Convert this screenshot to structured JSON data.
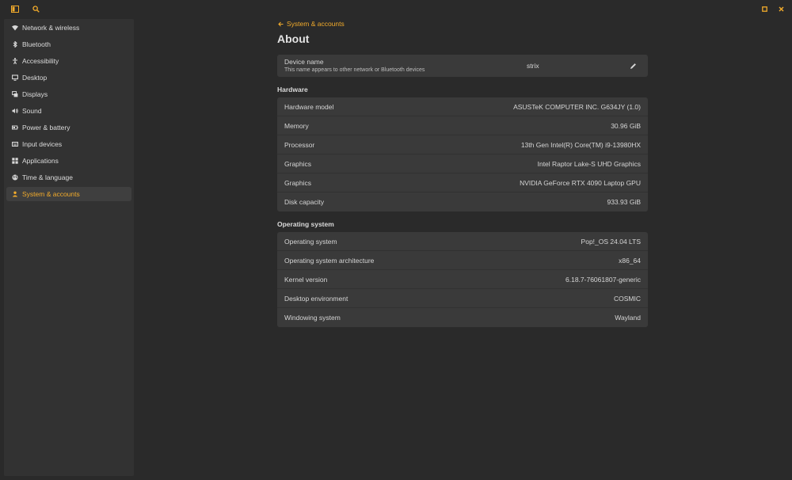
{
  "header": {
    "sidebar_toggle_icon": "sidebar-toggle-icon",
    "search_icon": "search-icon",
    "maximize_icon": "maximize-icon",
    "close_icon": "close-icon"
  },
  "colors": {
    "accent": "#f2ab2b",
    "background": "#2a2a2a",
    "panel": "#323232",
    "card": "#3a3a3a"
  },
  "sidebar": {
    "items": [
      {
        "label": "Network & wireless",
        "icon": "wifi-icon"
      },
      {
        "label": "Bluetooth",
        "icon": "bluetooth-icon"
      },
      {
        "label": "Accessibility",
        "icon": "accessibility-icon"
      },
      {
        "label": "Desktop",
        "icon": "desktop-icon"
      },
      {
        "label": "Displays",
        "icon": "displays-icon"
      },
      {
        "label": "Sound",
        "icon": "sound-icon"
      },
      {
        "label": "Power & battery",
        "icon": "battery-icon"
      },
      {
        "label": "Input devices",
        "icon": "keyboard-icon"
      },
      {
        "label": "Applications",
        "icon": "apps-icon"
      },
      {
        "label": "Time & language",
        "icon": "globe-icon"
      },
      {
        "label": "System & accounts",
        "icon": "user-icon",
        "active": true
      }
    ]
  },
  "page": {
    "back_label": "System & accounts",
    "title": "About"
  },
  "device": {
    "label": "Device name",
    "description": "This name appears to other network or Bluetooth devices",
    "value": "strix"
  },
  "hardware": {
    "title": "Hardware",
    "rows": [
      {
        "label": "Hardware model",
        "value": "ASUSTeK COMPUTER INC. G634JY (1.0)"
      },
      {
        "label": "Memory",
        "value": "30.96 GiB"
      },
      {
        "label": "Processor",
        "value": "13th Gen Intel(R) Core(TM) i9-13980HX"
      },
      {
        "label": "Graphics",
        "value": "Intel Raptor Lake-S UHD Graphics"
      },
      {
        "label": "Graphics",
        "value": "NVIDIA GeForce RTX 4090 Laptop GPU"
      },
      {
        "label": "Disk capacity",
        "value": "933.93 GiB"
      }
    ]
  },
  "os": {
    "title": "Operating system",
    "rows": [
      {
        "label": "Operating system",
        "value": "Pop!_OS 24.04 LTS"
      },
      {
        "label": "Operating system architecture",
        "value": "x86_64"
      },
      {
        "label": "Kernel version",
        "value": "6.18.7-76061807-generic"
      },
      {
        "label": "Desktop environment",
        "value": "COSMIC"
      },
      {
        "label": "Windowing system",
        "value": "Wayland"
      }
    ]
  }
}
